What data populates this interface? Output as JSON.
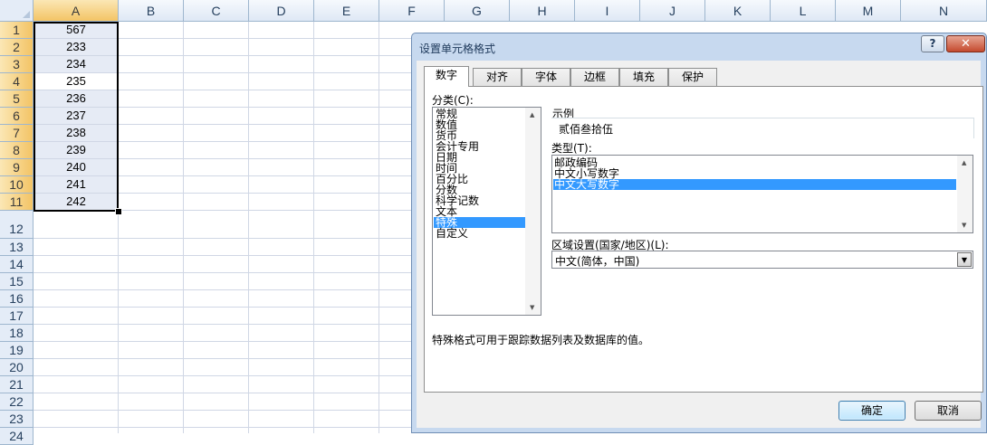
{
  "spreadsheet": {
    "columns": [
      "A",
      "B",
      "C",
      "D",
      "E",
      "F",
      "G",
      "H",
      "I",
      "J",
      "K",
      "L",
      "M",
      "N"
    ],
    "rows": [
      "1",
      "2",
      "3",
      "4",
      "5",
      "6",
      "7",
      "8",
      "9",
      "10",
      "11",
      "12",
      "13",
      "14",
      "15",
      "16",
      "17",
      "18",
      "19",
      "20",
      "21",
      "22",
      "23",
      "24"
    ],
    "values": [
      "567",
      "233",
      "234",
      "235",
      "236",
      "237",
      "238",
      "239",
      "240",
      "241",
      "242"
    ],
    "selected_column": "A",
    "active_cell": "A4"
  },
  "dialog": {
    "title": "设置单元格格式",
    "help_label": "?",
    "close_label": "✕",
    "tabs": [
      {
        "label": "数字",
        "active": true
      },
      {
        "label": "对齐"
      },
      {
        "label": "字体"
      },
      {
        "label": "边框"
      },
      {
        "label": "填充"
      },
      {
        "label": "保护"
      }
    ],
    "category_label": "分类(C):",
    "categories": [
      "常规",
      "数值",
      "货币",
      "会计专用",
      "日期",
      "时间",
      "百分比",
      "分数",
      "科学记数",
      "文本",
      "特殊",
      "自定义"
    ],
    "selected_category": "特殊",
    "sample_label": "示例",
    "sample_value": "贰佰叁拾伍",
    "type_label": "类型(T):",
    "types": [
      "邮政编码",
      "中文小写数字",
      "中文大写数字"
    ],
    "selected_type": "中文大写数字",
    "locale_label": "区域设置(国家/地区)(L):",
    "locale_value": "中文(简体，中国)",
    "description": "特殊格式可用于跟踪数据列表及数据库的值。",
    "ok_label": "确定",
    "cancel_label": "取消"
  },
  "colors": {
    "dialog_frame": "#c7d9ef",
    "selection_highlight": "#3399ff",
    "header_selected": "#f3c465"
  }
}
